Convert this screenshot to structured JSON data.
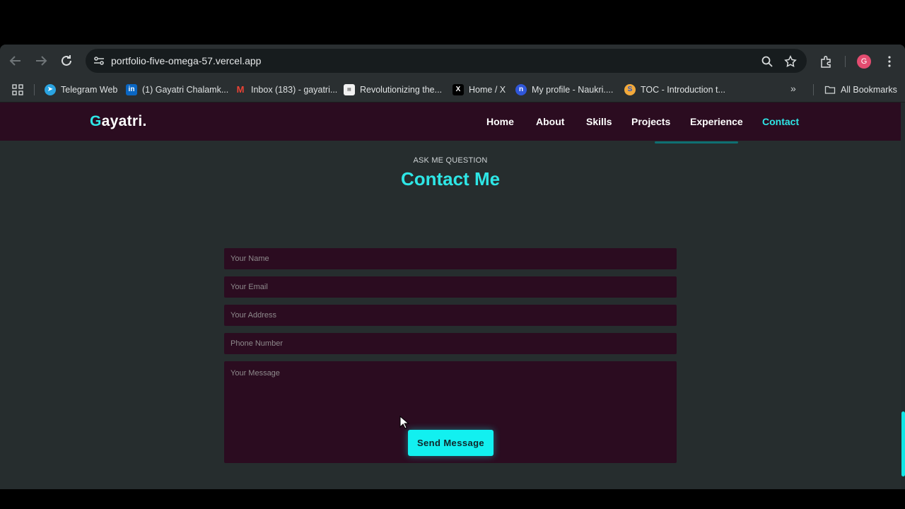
{
  "browser": {
    "url": "portfolio-five-omega-57.vercel.app",
    "avatar_initial": "G",
    "bookmarks": [
      {
        "label": "Telegram Web",
        "icon": "telegram-icon"
      },
      {
        "label": "(1) Gayatri Chalamk...",
        "icon": "linkedin-icon"
      },
      {
        "label": "Inbox (183) - gayatri...",
        "icon": "gmail-icon"
      },
      {
        "label": "Revolutionizing the...",
        "icon": "news-icon"
      },
      {
        "label": "Home / X",
        "icon": "x-icon"
      },
      {
        "label": "My profile - Naukri....",
        "icon": "naukri-icon"
      },
      {
        "label": "TOC - Introduction t...",
        "icon": "course-icon"
      }
    ],
    "all_bookmarks": "All Bookmarks"
  },
  "site": {
    "logo_first": "G",
    "logo_rest": "ayatri.",
    "nav": [
      {
        "label": "Home"
      },
      {
        "label": "About"
      },
      {
        "label": "Skills"
      },
      {
        "label": "Projects"
      },
      {
        "label": "Experience"
      },
      {
        "label": "Contact",
        "active": true
      }
    ],
    "kicker": "ASK ME QUESTION",
    "heading": "Contact Me",
    "form": {
      "name_placeholder": "Your Name",
      "email_placeholder": "Your Email",
      "address_placeholder": "Your Address",
      "phone_placeholder": "Phone Number",
      "message_placeholder": "Your Message",
      "submit_label": "Send Message"
    }
  },
  "colors": {
    "accent": "#2ee6e6",
    "nav_bg": "#2b0c20",
    "page_bg": "#262d2e",
    "button_bg": "#12f0f0"
  }
}
